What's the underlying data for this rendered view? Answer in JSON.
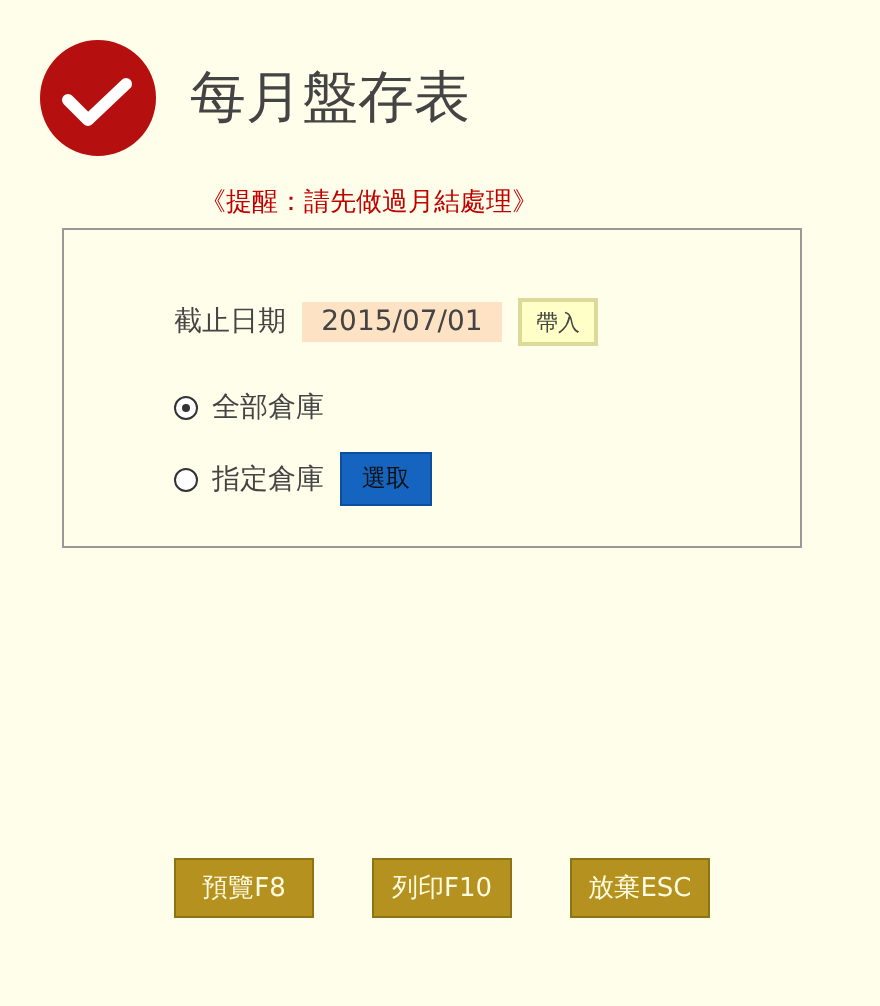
{
  "title": "每月盤存表",
  "notice": "《提醒：請先做過月結處理》",
  "cutoff": {
    "label": "截止日期",
    "value": "2015/07/01",
    "button": "帶入"
  },
  "warehouse_options": [
    {
      "label": "全部倉庫",
      "selected": true
    },
    {
      "label": "指定倉庫",
      "selected": false,
      "button": "選取"
    }
  ],
  "buttons": [
    "預覽F8",
    "列印F10",
    "放棄ESC"
  ]
}
